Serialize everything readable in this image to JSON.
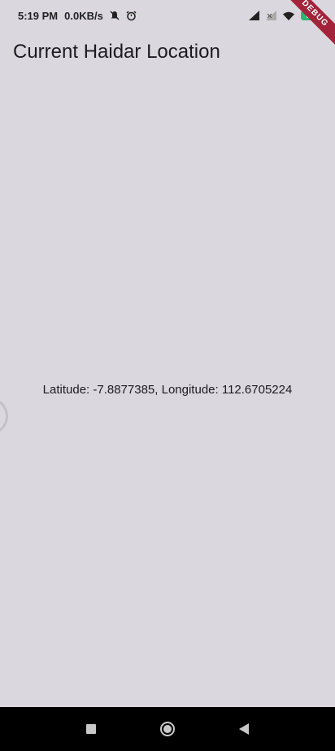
{
  "status_bar": {
    "time": "5:19 PM",
    "network_speed": "0.0KB/s",
    "battery_level": "69",
    "icons": [
      "mute-icon",
      "alarm-icon",
      "signal-icon",
      "signal-off-icon",
      "wifi-icon",
      "battery-icon"
    ]
  },
  "debug_banner": "DEBUG",
  "app_bar": {
    "title": "Current Haidar Location"
  },
  "location": {
    "text": "Latitude: -7.8877385, Longitude: 112.6705224"
  },
  "nav_bar": {
    "buttons": [
      "recents-button",
      "home-button",
      "back-button"
    ]
  },
  "colors": {
    "background": "#dad8de",
    "banner": "#a3233a",
    "battery": "#2bb673",
    "nav_bar": "#000000"
  }
}
